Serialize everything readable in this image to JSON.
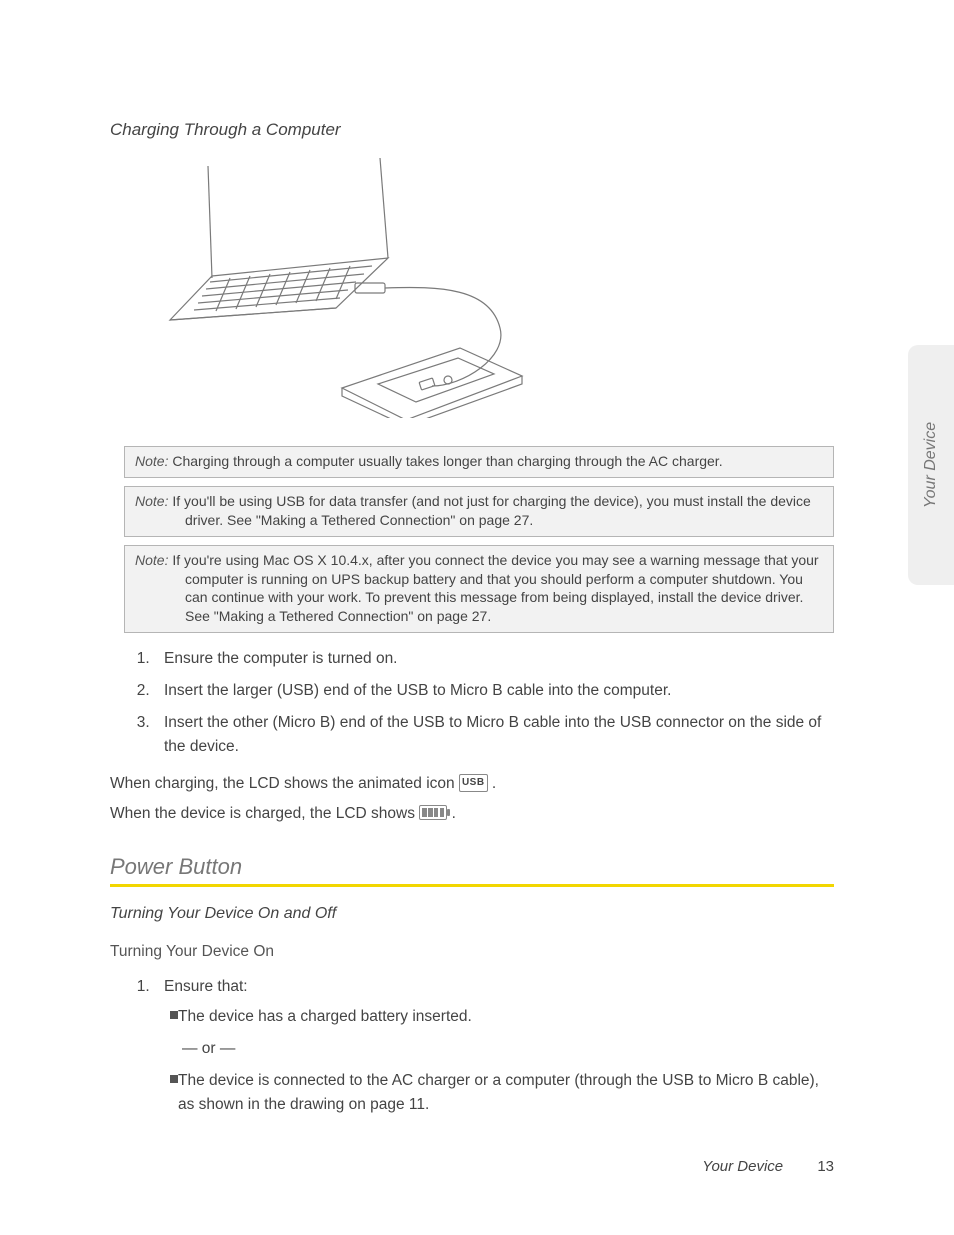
{
  "headings": {
    "charging": "Charging Through a Computer",
    "power": "Power Button",
    "turning": "Turning Your Device On and Off",
    "turningOn": "Turning Your Device On"
  },
  "notes": {
    "label": "Note:",
    "n1": "Charging through a computer usually takes longer than charging through the AC charger.",
    "n2": "If you'll be using USB for data transfer (and not just for charging the device), you must install the device driver. See \"Making a Tethered Connection\" on page 27.",
    "n3": "If you're using Mac OS X 10.4.x, after you connect the device you may see a warning message that your computer is running on UPS backup battery and that you should perform a computer shutdown. You can continue with your work. To prevent this message from being displayed, install the device driver. See \"Making a Tethered Connection\" on page 27."
  },
  "steps": {
    "s1": "Ensure the computer is turned on.",
    "s2": "Insert the larger (USB) end of the USB to Micro B cable into the computer.",
    "s3": "Insert the other (Micro B) end of the USB to Micro B cable into the USB connector on the side of the device."
  },
  "body": {
    "line1a": "When charging, the LCD shows the animated icon ",
    "line1b": ".",
    "line2a": "When the device is charged, the LCD shows ",
    "line2b": "."
  },
  "icons": {
    "usb": "USB"
  },
  "ensure": {
    "lead": "Ensure that:",
    "b1": "The device has a charged battery inserted.",
    "or": "— or —",
    "b2": "The device is connected to the AC charger or a computer (through the USB to Micro B cable), as shown in the drawing on page 11."
  },
  "sideTab": "Your Device",
  "footer": {
    "section": "Your Device",
    "page": "13"
  }
}
